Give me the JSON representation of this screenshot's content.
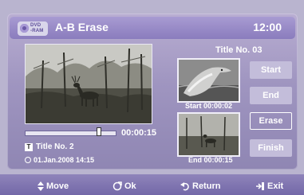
{
  "header": {
    "disc_line1": "DVD",
    "disc_line2": "-RAM",
    "title": "A-B Erase",
    "clock": "12:00"
  },
  "preview": {
    "timecode": "00:00:15",
    "progress_fraction": 0.82,
    "title": "Title No. 2",
    "date": "01.Jan.2008  14:15"
  },
  "right_panel": {
    "title": "Title No. 03",
    "start_label": "Start 00:00:02",
    "end_label": "End 00:00:15"
  },
  "buttons": [
    {
      "label": "Start"
    },
    {
      "label": "End"
    },
    {
      "label": "Erase"
    },
    {
      "label": "Finish"
    }
  ],
  "bottom": {
    "move": "Move",
    "ok": "Ok",
    "return": "Return",
    "exit": "Exit"
  }
}
